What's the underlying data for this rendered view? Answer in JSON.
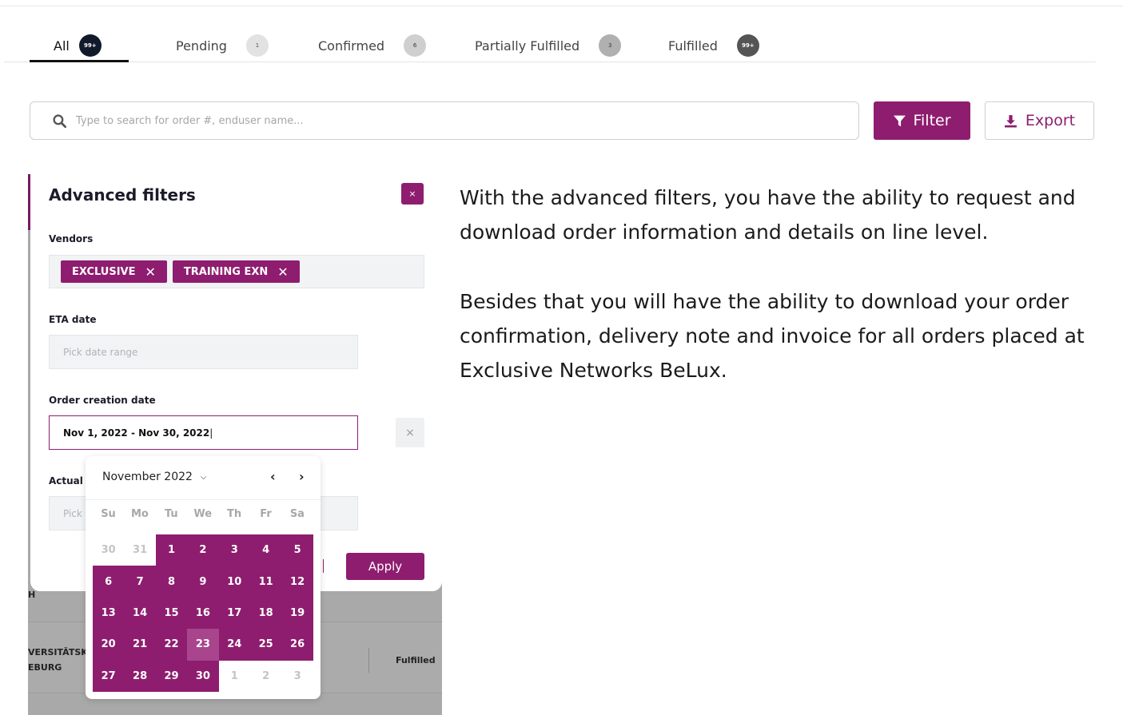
{
  "tabs": [
    {
      "label": "All",
      "count": "99+"
    },
    {
      "label": "Pending",
      "count": "1"
    },
    {
      "label": "Confirmed",
      "count": "6"
    },
    {
      "label": "Partially Fulfilled",
      "count": "3"
    },
    {
      "label": "Fulfilled",
      "count": "99+"
    }
  ],
  "search": {
    "placeholder": "Type to search for order #, enduser name..."
  },
  "toolbar": {
    "filter_label": "Filter",
    "export_label": "Export"
  },
  "background_table": {
    "fragment_1": "H",
    "fragment_2": "VERSITÄTSKLI",
    "fragment_3": "EBURG",
    "status": "Fulfilled"
  },
  "filters": {
    "title": "Advanced filters",
    "close_label": "×",
    "vendors_label": "Vendors",
    "vendors": [
      "EXCLUSIVE",
      "TRAINING EXN"
    ],
    "eta_label": "ETA date",
    "eta_placeholder": "Pick date range",
    "order_creation_label": "Order creation date",
    "order_creation_value": "Nov 1, 2022 - Nov 30, 2022",
    "actual_label": "Actual s",
    "actual_placeholder": "Pick",
    "clear_label": "×",
    "apply_label": "Apply"
  },
  "calendar": {
    "month": "November 2022",
    "weekdays": [
      "Su",
      "Mo",
      "Tu",
      "We",
      "Th",
      "Fr",
      "Sa"
    ],
    "days": [
      {
        "d": "30",
        "state": "out"
      },
      {
        "d": "31",
        "state": "out"
      },
      {
        "d": "1",
        "state": "in"
      },
      {
        "d": "2",
        "state": "in"
      },
      {
        "d": "3",
        "state": "in"
      },
      {
        "d": "4",
        "state": "in"
      },
      {
        "d": "5",
        "state": "in"
      },
      {
        "d": "6",
        "state": "in"
      },
      {
        "d": "7",
        "state": "in"
      },
      {
        "d": "8",
        "state": "in"
      },
      {
        "d": "9",
        "state": "in"
      },
      {
        "d": "10",
        "state": "in"
      },
      {
        "d": "11",
        "state": "in"
      },
      {
        "d": "12",
        "state": "in"
      },
      {
        "d": "13",
        "state": "in"
      },
      {
        "d": "14",
        "state": "in"
      },
      {
        "d": "15",
        "state": "in"
      },
      {
        "d": "16",
        "state": "in"
      },
      {
        "d": "17",
        "state": "in"
      },
      {
        "d": "18",
        "state": "in"
      },
      {
        "d": "19",
        "state": "in"
      },
      {
        "d": "20",
        "state": "in"
      },
      {
        "d": "21",
        "state": "in"
      },
      {
        "d": "22",
        "state": "in"
      },
      {
        "d": "23",
        "state": "today"
      },
      {
        "d": "24",
        "state": "in"
      },
      {
        "d": "25",
        "state": "in"
      },
      {
        "d": "26",
        "state": "in"
      },
      {
        "d": "27",
        "state": "in"
      },
      {
        "d": "28",
        "state": "in"
      },
      {
        "d": "29",
        "state": "in"
      },
      {
        "d": "30",
        "state": "in"
      },
      {
        "d": "1",
        "state": "out"
      },
      {
        "d": "2",
        "state": "out"
      },
      {
        "d": "3",
        "state": "out"
      }
    ]
  },
  "description": {
    "p1": "With the advanced filters, you have the ability to request and download order information and details on line level.",
    "p2": "Besides that you will have the ability to download your order confirmation, delivery note and invoice for all orders placed at Exclusive Networks BeLux."
  },
  "colors": {
    "accent": "#8e1d6f",
    "badge_dark": "#111a2b"
  }
}
